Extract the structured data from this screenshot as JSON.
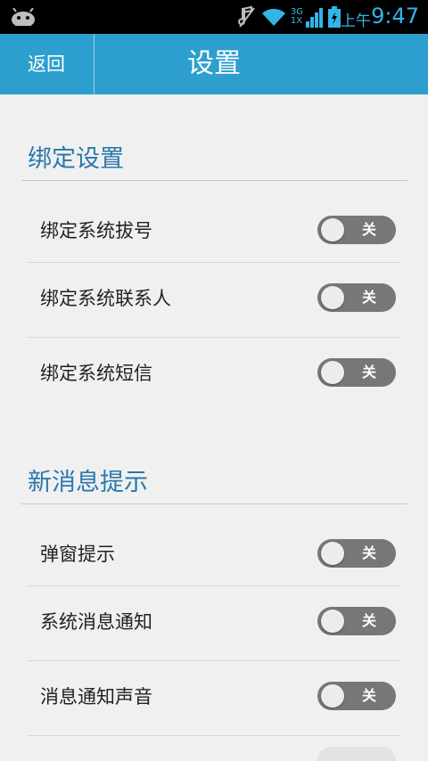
{
  "status_bar": {
    "ampm": "上午",
    "time": "9:47",
    "network_label": "3G",
    "network_sub": "1X",
    "color": "#33b5e5",
    "icons": [
      "android-icon",
      "mute-icon",
      "wifi-icon",
      "signal-icon",
      "battery-charging-icon"
    ]
  },
  "header": {
    "back_label": "返回",
    "title": "设置",
    "bar_color": "#2d9fcf"
  },
  "sections": [
    {
      "title": "绑定设置",
      "items": [
        {
          "label": "绑定系统拔号",
          "toggle": "关"
        },
        {
          "label": "绑定系统联系人",
          "toggle": "关"
        },
        {
          "label": "绑定系统短信",
          "toggle": "关"
        }
      ]
    },
    {
      "title": "新消息提示",
      "items": [
        {
          "label": "弹窗提示",
          "toggle": "关"
        },
        {
          "label": "系统消息通知",
          "toggle": "关"
        },
        {
          "label": "消息通知声音",
          "toggle": "关"
        }
      ]
    }
  ],
  "colors": {
    "section_title": "#2a78ad",
    "toggle_off": "#777777"
  }
}
